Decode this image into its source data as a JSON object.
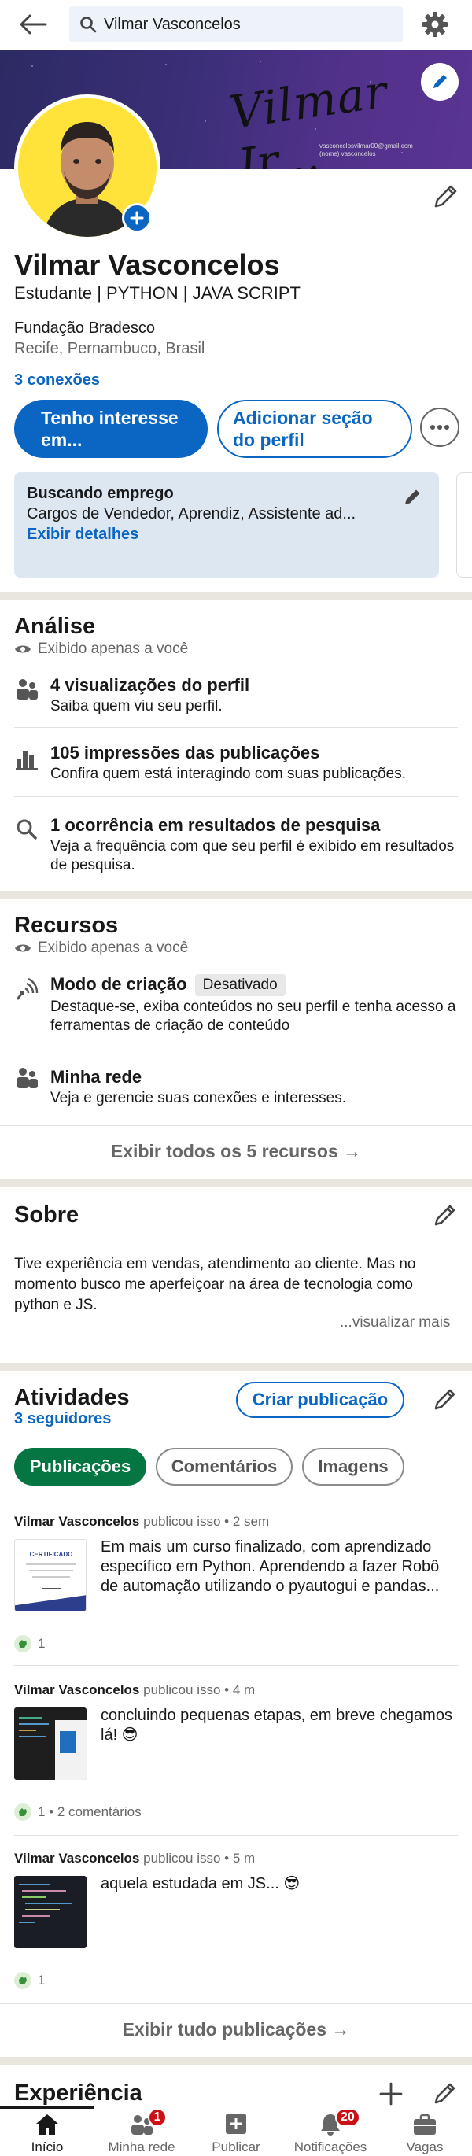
{
  "search": {
    "value": "Vilmar Vasconcelos"
  },
  "cover": {
    "signature": "Vilmar Jr...",
    "email_lines": [
      "vasconcelosvilmar00@gmail.com",
      "(nome) vasconcelos"
    ]
  },
  "profile": {
    "name": "Vilmar Vasconcelos",
    "headline": "Estudante | PYTHON | JAVA SCRIPT",
    "education": "Fundação Bradesco",
    "location": "Recife, Pernambuco, Brasil",
    "connections": "3 conexões",
    "btn_interest": "Tenho interesse em...",
    "btn_add_section": "Adicionar seção do perfil"
  },
  "open_to_work": {
    "title": "Buscando emprego",
    "roles": "Cargos de Vendedor, Aprendiz, Assistente ad...",
    "details_link": "Exibir detalhes"
  },
  "analytics": {
    "title": "Análise",
    "private_note": "Exibido apenas a você",
    "items": [
      {
        "title": "4 visualizações do perfil",
        "subtitle": "Saiba quem viu seu perfil."
      },
      {
        "title": "105 impressões das publicações",
        "subtitle": "Confira quem está interagindo com suas publicações."
      },
      {
        "title": "1 ocorrência em resultados de pesquisa",
        "subtitle": "Veja a frequência com que seu perfil é exibido em resultados de pesquisa."
      }
    ]
  },
  "resources": {
    "title": "Recursos",
    "private_note": "Exibido apenas a você",
    "items": [
      {
        "title": "Modo de criação",
        "badge": "Desativado",
        "subtitle": "Destaque-se, exiba conteúdos no seu perfil e tenha acesso a ferramentas de criação de conteúdo"
      },
      {
        "title": "Minha rede",
        "subtitle": "Veja e gerencie suas conexões e interesses."
      }
    ],
    "show_all": "Exibir todos os 5 recursos →"
  },
  "about": {
    "title": "Sobre",
    "text": "Tive experiência em vendas, atendimento ao cliente. Mas no momento busco me aperfeiçoar na área de tecnologia como python e JS.",
    "see_more": "...visualizar mais"
  },
  "activity": {
    "title": "Atividades",
    "followers": "3 seguidores",
    "create_post": "Criar publicação",
    "tabs": [
      "Publicações",
      "Comentários",
      "Imagens"
    ],
    "posts": [
      {
        "author": "Vilmar Vasconcelos",
        "action": "publicou isso",
        "time": "2 sem",
        "text": "Em mais um curso finalizado, com aprendizado específico em Python. Aprendendo a fazer Robô de automação utilizando o pyautogui e pandas...",
        "thumb_label": "CERTIFICADO",
        "reactions": "1"
      },
      {
        "author": "Vilmar Vasconcelos",
        "action": "publicou isso",
        "time": "4 m",
        "text": "concluindo pequenas etapas, em breve chegamos lá! 😎",
        "reactions": "1 • 2 comentários"
      },
      {
        "author": "Vilmar Vasconcelos",
        "action": "publicou isso",
        "time": "5 m",
        "text": "aquela estudada em JS... 😎",
        "reactions": "1"
      }
    ],
    "show_all": "Exibir tudo publicações →"
  },
  "experience": {
    "title": "Experiência"
  },
  "nav": {
    "items": [
      {
        "label": "Início"
      },
      {
        "label": "Minha rede",
        "badge": "1"
      },
      {
        "label": "Publicar"
      },
      {
        "label": "Notificações",
        "badge": "20"
      },
      {
        "label": "Vagas"
      }
    ]
  },
  "colors": {
    "brand": "#0a66c2",
    "active_pill": "#057642",
    "badge": "#cc1016",
    "avatar_bg": "#ffe33a"
  }
}
